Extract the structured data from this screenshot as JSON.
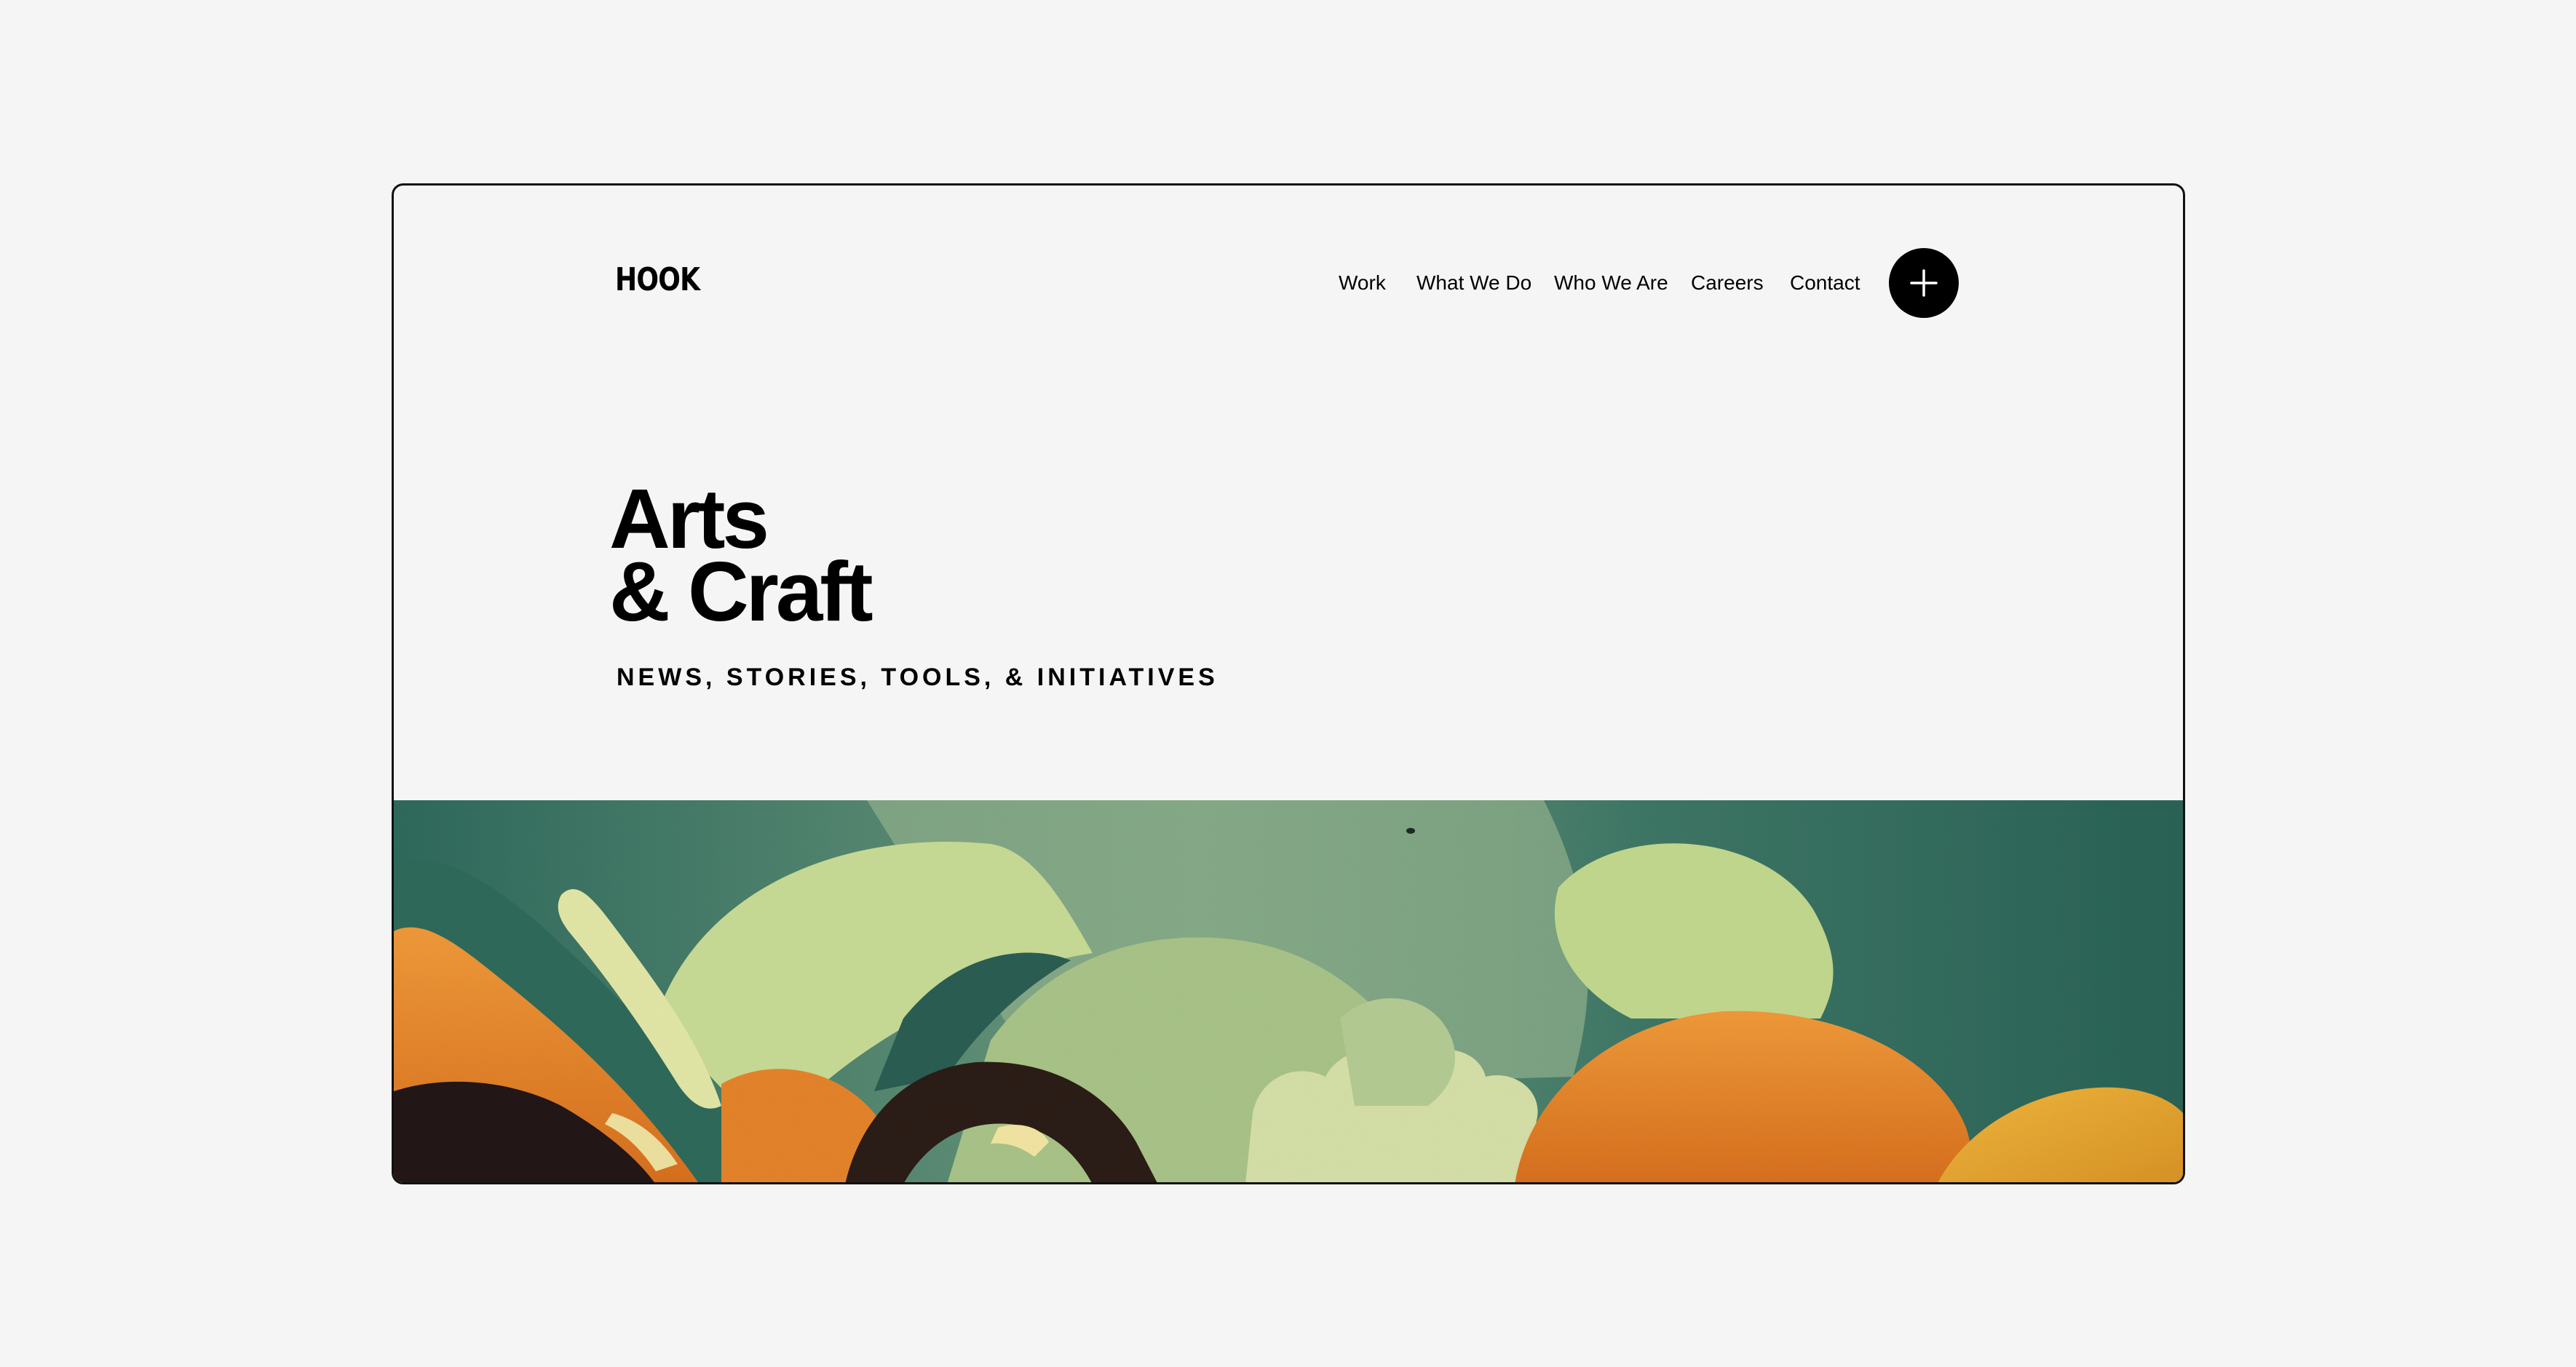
{
  "header": {
    "logo": "HOOK",
    "nav": [
      {
        "label": "Work"
      },
      {
        "label": "What We Do"
      },
      {
        "label": "Who We Are"
      },
      {
        "label": "Careers"
      },
      {
        "label": "Contact"
      }
    ],
    "menu_button_icon": "plus-icon"
  },
  "hero": {
    "title_line1": "Arts",
    "title_line2": "& Craft",
    "subtitle": "NEWS, STORIES, TOOLS, & INITIATIVES"
  },
  "banner": {
    "image": "abstract-landscape-illustration"
  },
  "colors": {
    "background": "#f5f5f5",
    "text": "#000000",
    "teal": "#2f6b5e",
    "sage": "#9fc18a",
    "pale_green": "#c9dc98",
    "orange": "#e8892c",
    "dark_brown": "#2c1c16"
  }
}
